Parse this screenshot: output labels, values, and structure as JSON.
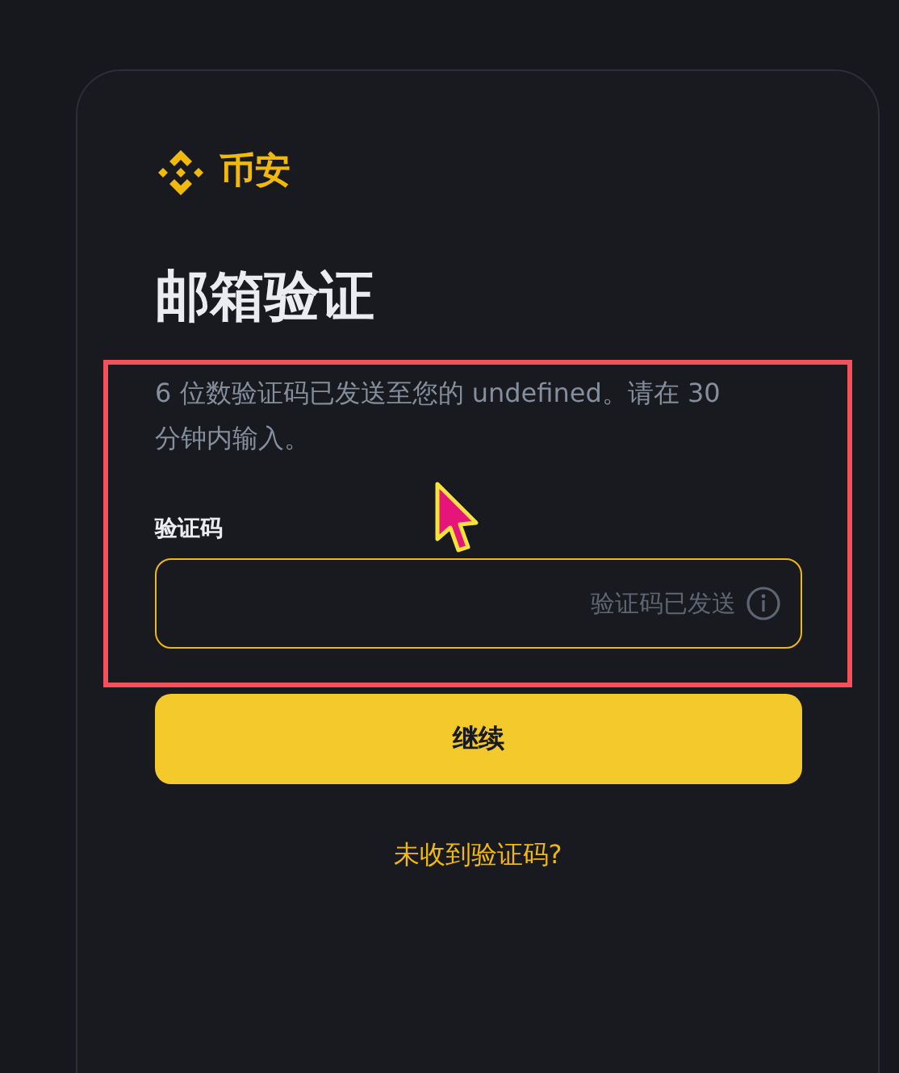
{
  "logo": {
    "text": "币安"
  },
  "title": "邮箱验证",
  "description": "6 位数验证码已发送至您的 undefined。请在 30 分钟内输入。",
  "code_field": {
    "label": "验证码",
    "status": "验证码已发送"
  },
  "continue_button": "继续",
  "resend_link": "未收到验证码?"
}
